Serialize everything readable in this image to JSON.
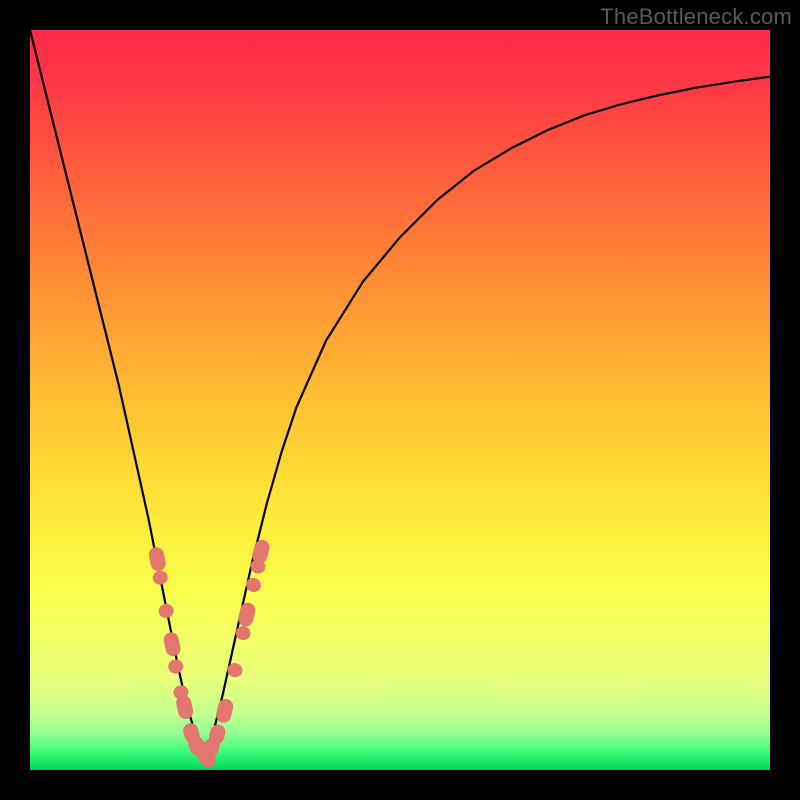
{
  "watermark": "TheBottleneck.com",
  "colors": {
    "frame": "#000000",
    "curve_stroke": "#000000",
    "marker_fill": "#e3766f",
    "marker_stroke": "#c85a53",
    "gradient_top": "#ff2a4b",
    "gradient_bottom": "#07cf57"
  },
  "chart_data": {
    "type": "line",
    "title": "",
    "xlabel": "",
    "ylabel": "",
    "xlim": [
      0,
      100
    ],
    "ylim": [
      0,
      100
    ],
    "grid": false,
    "legend": false,
    "note": "Axes have no visible tick labels in the image; x/y are percentage of plot area. y=0 is bottom/green, y=100 is top/red. Single V-shaped curve with minimum near x≈23.5.",
    "series": [
      {
        "name": "bottleneck-curve",
        "x": [
          0,
          2,
          4,
          6,
          8,
          10,
          12,
          14,
          16,
          17,
          18,
          19,
          20,
          21,
          22,
          23,
          23.5,
          24,
          25,
          26,
          27,
          28,
          29,
          30,
          32,
          34,
          36,
          40,
          45,
          50,
          55,
          60,
          65,
          70,
          75,
          80,
          85,
          90,
          95,
          100
        ],
        "y": [
          100,
          92,
          84,
          76,
          68,
          60,
          52,
          43,
          34,
          29,
          24,
          19,
          14,
          9.5,
          6,
          3,
          2,
          3,
          6,
          10,
          14.5,
          19,
          23.5,
          28,
          36,
          43,
          49,
          58,
          66,
          72,
          77,
          81,
          84,
          86.5,
          88.5,
          90,
          91.2,
          92.2,
          93,
          93.7
        ]
      }
    ],
    "markers": {
      "name": "highlighted-points",
      "note": "Salmon capsule/dot markers clustered around the curve minimum.",
      "points": [
        {
          "x": 17.2,
          "y": 28.5
        },
        {
          "x": 17.6,
          "y": 26.0
        },
        {
          "x": 18.4,
          "y": 21.5
        },
        {
          "x": 19.2,
          "y": 17.0
        },
        {
          "x": 19.7,
          "y": 14.0
        },
        {
          "x": 20.4,
          "y": 10.5
        },
        {
          "x": 20.9,
          "y": 8.5
        },
        {
          "x": 21.8,
          "y": 5.0
        },
        {
          "x": 22.5,
          "y": 3.3
        },
        {
          "x": 23.5,
          "y": 2.2
        },
        {
          "x": 24.5,
          "y": 3.0
        },
        {
          "x": 25.3,
          "y": 4.8
        },
        {
          "x": 26.3,
          "y": 8.0
        },
        {
          "x": 27.7,
          "y": 13.5
        },
        {
          "x": 28.8,
          "y": 18.5
        },
        {
          "x": 29.3,
          "y": 21.0
        },
        {
          "x": 30.2,
          "y": 25.0
        },
        {
          "x": 30.8,
          "y": 27.5
        },
        {
          "x": 31.2,
          "y": 29.5
        }
      ]
    }
  }
}
